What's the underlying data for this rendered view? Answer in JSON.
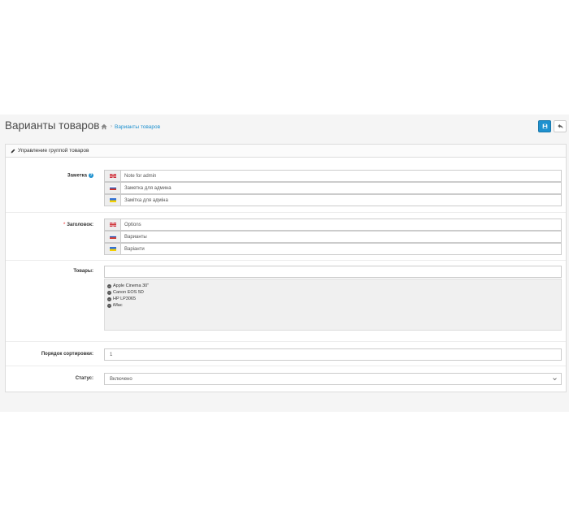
{
  "header": {
    "title": "Варианты товаров",
    "breadcrumb": "Варианты товаров",
    "breadcrumb_sep": "›",
    "buttons": [
      {
        "name": "save",
        "icon": "save-icon",
        "color": "#1e91cf"
      },
      {
        "name": "back",
        "icon": "reply-icon"
      }
    ]
  },
  "panel": {
    "heading": "Управление группой товаров",
    "heading_icon": "pencil-icon"
  },
  "form": {
    "note": {
      "label": "Заметка",
      "has_help": true,
      "values": [
        {
          "lang_flag": "flag-gb",
          "value": "Note for admin"
        },
        {
          "lang_flag": "flag-ru",
          "value": "Заметка для админа"
        },
        {
          "lang_flag": "flag-ua",
          "value": "Замітка для адміна"
        }
      ]
    },
    "title": {
      "label": "Заголовок:",
      "required_mark": "*",
      "values": [
        {
          "lang_flag": "flag-gb",
          "value": "Options"
        },
        {
          "lang_flag": "flag-ru",
          "value": "Варианты"
        },
        {
          "lang_flag": "flag-ua",
          "value": "Варіанти"
        }
      ]
    },
    "products": {
      "label": "Товары:",
      "input_value": "",
      "items": [
        "Apple Cinema 30\"",
        "Canon EOS 5D",
        "HP LP3065",
        "iMac"
      ]
    },
    "sort_order": {
      "label": "Порядок сортировки:",
      "value": "1"
    },
    "status": {
      "label": "Статус:",
      "value": "Включено"
    }
  },
  "colors": {
    "accent": "#1e91cf",
    "required": "#f56b6b"
  }
}
